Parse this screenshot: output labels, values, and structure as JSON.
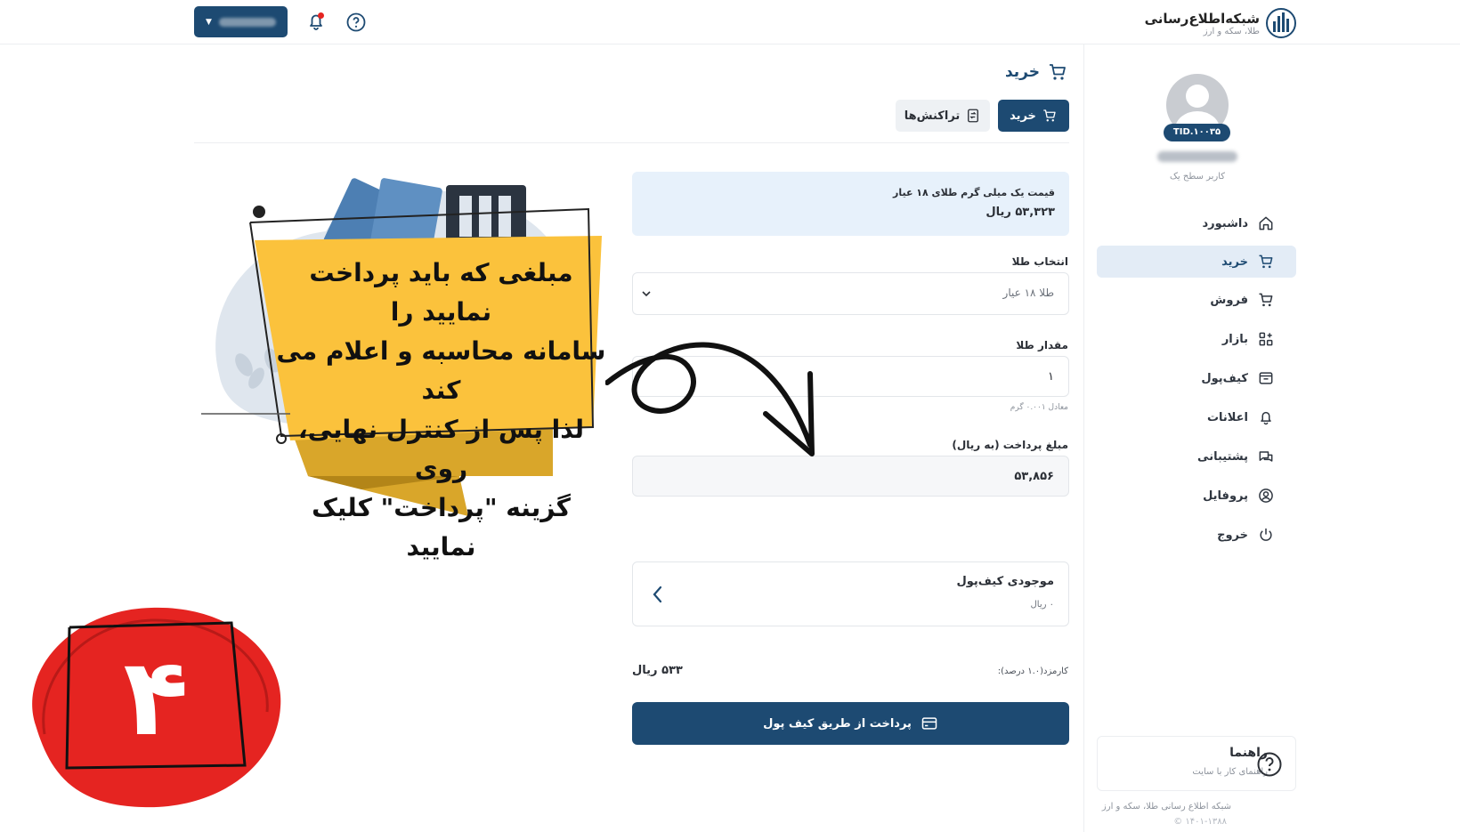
{
  "topbar": {
    "brand_title": "شبکه‌اطلاع‌رسانی",
    "brand_sub": "طلا، سکه و ارز",
    "user_button_label": ""
  },
  "sidebar": {
    "tid": "TID.۱۰۰۳۵",
    "user_level": "کاربر سطح یک",
    "items": [
      {
        "label": "داشبورد",
        "icon": "home-icon"
      },
      {
        "label": "خرید",
        "icon": "cart-icon",
        "active": true
      },
      {
        "label": "فروش",
        "icon": "cart-outline-icon"
      },
      {
        "label": "بازار",
        "icon": "market-icon"
      },
      {
        "label": "کیف‌پول",
        "icon": "wallet-icon"
      },
      {
        "label": "اعلانات",
        "icon": "bell-icon"
      },
      {
        "label": "پشتیبانی",
        "icon": "chat-icon"
      },
      {
        "label": "پروفایل",
        "icon": "user-circle-icon"
      },
      {
        "label": "خروج",
        "icon": "power-icon"
      }
    ],
    "help": {
      "title": "راهنما",
      "subtitle": "راهنمای کار با سایت"
    },
    "footer": {
      "line1": "شبکه اطلاع رسانی طلا، سکه و ارز",
      "line2": "© ۱۴۰۱-۱۳۸۸"
    }
  },
  "main": {
    "title": "خرید",
    "tabs": {
      "buy": "خرید",
      "transactions": "تراکنش‌ها"
    },
    "price": {
      "label": "قیمت یک میلی گرم طلای ۱۸ عیار",
      "value": "۵۳,۳۲۳ ریال"
    },
    "gold_select": {
      "label": "انتخاب طلا",
      "value": "طلا ۱۸ عیار"
    },
    "gold_amount": {
      "label": "مقدار طلا",
      "value": "۱",
      "hint": "معادل ۰.۰۰۱ گرم"
    },
    "payment_amount": {
      "label": "مبلغ پرداخت (به ریال)",
      "value": "۵۳,۸۵۶"
    },
    "wallet": {
      "title": "موجودی کیف‌پول",
      "value": "۰ ریال"
    },
    "fee": {
      "label": "کارمزد(۱.۰ درصد):",
      "value": "۵۳۳ ریال"
    },
    "pay_button": "پرداخت از طریق کیف پول"
  },
  "annotation": {
    "callout_lines": [
      "مبلغی که باید پرداخت نمایید را",
      "سامانه محاسبه و اعلام می کند",
      "لذا پس از کنترل نهایی، روی",
      "گزینه \"پرداخت\" کلیک نمایید"
    ],
    "step_number": "۴"
  },
  "colors": {
    "primary": "#1d4a72",
    "active_bg": "#e3ecf6",
    "callout": "#fbc23c",
    "badge": "#e52421"
  }
}
